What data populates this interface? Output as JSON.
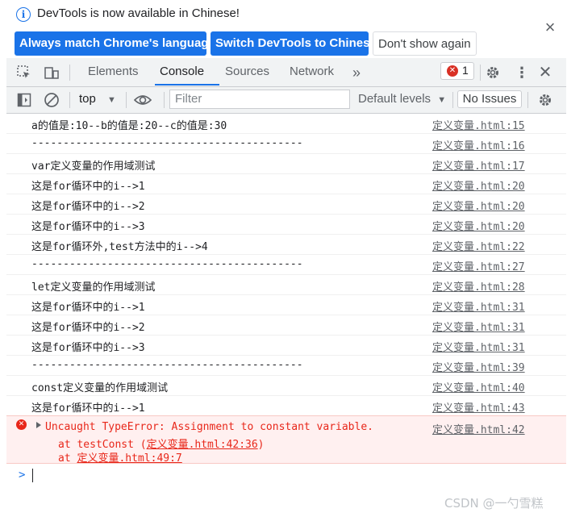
{
  "infobar": {
    "message": "DevTools is now available in Chinese!",
    "btn_match": "Always match Chrome's language",
    "btn_switch": "Switch DevTools to Chinese",
    "btn_dismiss": "Don't show again"
  },
  "tabs": [
    "Elements",
    "Console",
    "Sources",
    "Network"
  ],
  "active_tab": "Console",
  "error_count": "1",
  "filterbar": {
    "context": "top",
    "filter_placeholder": "Filter",
    "levels": "Default levels",
    "issues": "No Issues"
  },
  "console": {
    "rows": [
      {
        "msg": "a的值是:10--b的值是:20--c的值是:30",
        "src": "定义变量.html:15"
      },
      {
        "msg": "-------------------------------------------",
        "src": "定义变量.html:16"
      },
      {
        "msg": "var定义变量的作用域测试",
        "src": "定义变量.html:17"
      },
      {
        "msg": "这是for循环中的i-->1",
        "src": "定义变量.html:20"
      },
      {
        "msg": "这是for循环中的i-->2",
        "src": "定义变量.html:20"
      },
      {
        "msg": "这是for循环中的i-->3",
        "src": "定义变量.html:20"
      },
      {
        "msg": "这是for循环外,test方法中的i-->4",
        "src": "定义变量.html:22"
      },
      {
        "msg": "-------------------------------------------",
        "src": "定义变量.html:27"
      },
      {
        "msg": "let定义变量的作用域测试",
        "src": "定义变量.html:28"
      },
      {
        "msg": "这是for循环中的i-->1",
        "src": "定义变量.html:31"
      },
      {
        "msg": "这是for循环中的i-->2",
        "src": "定义变量.html:31"
      },
      {
        "msg": "这是for循环中的i-->3",
        "src": "定义变量.html:31"
      },
      {
        "msg": "-------------------------------------------",
        "src": "定义变量.html:39"
      },
      {
        "msg": "const定义变量的作用域测试",
        "src": "定义变量.html:40"
      },
      {
        "msg": "这是for循环中的i-->1",
        "src": "定义变量.html:43"
      }
    ],
    "error": {
      "message": "Uncaught TypeError: Assignment to constant variable.",
      "src": "定义变量.html:42",
      "stack1_prefix": "at testConst (",
      "stack1_link": "定义变量.html:42:36",
      "stack1_suffix": ")",
      "stack2_prefix": "at ",
      "stack2_link": "定义变量.html:49:7"
    },
    "prompt": ">"
  },
  "watermark": "CSDN @一勺雪糕",
  "colors": {
    "accent": "#1a73e8",
    "error": "#e8271a",
    "error_bg": "#fff0f0"
  }
}
